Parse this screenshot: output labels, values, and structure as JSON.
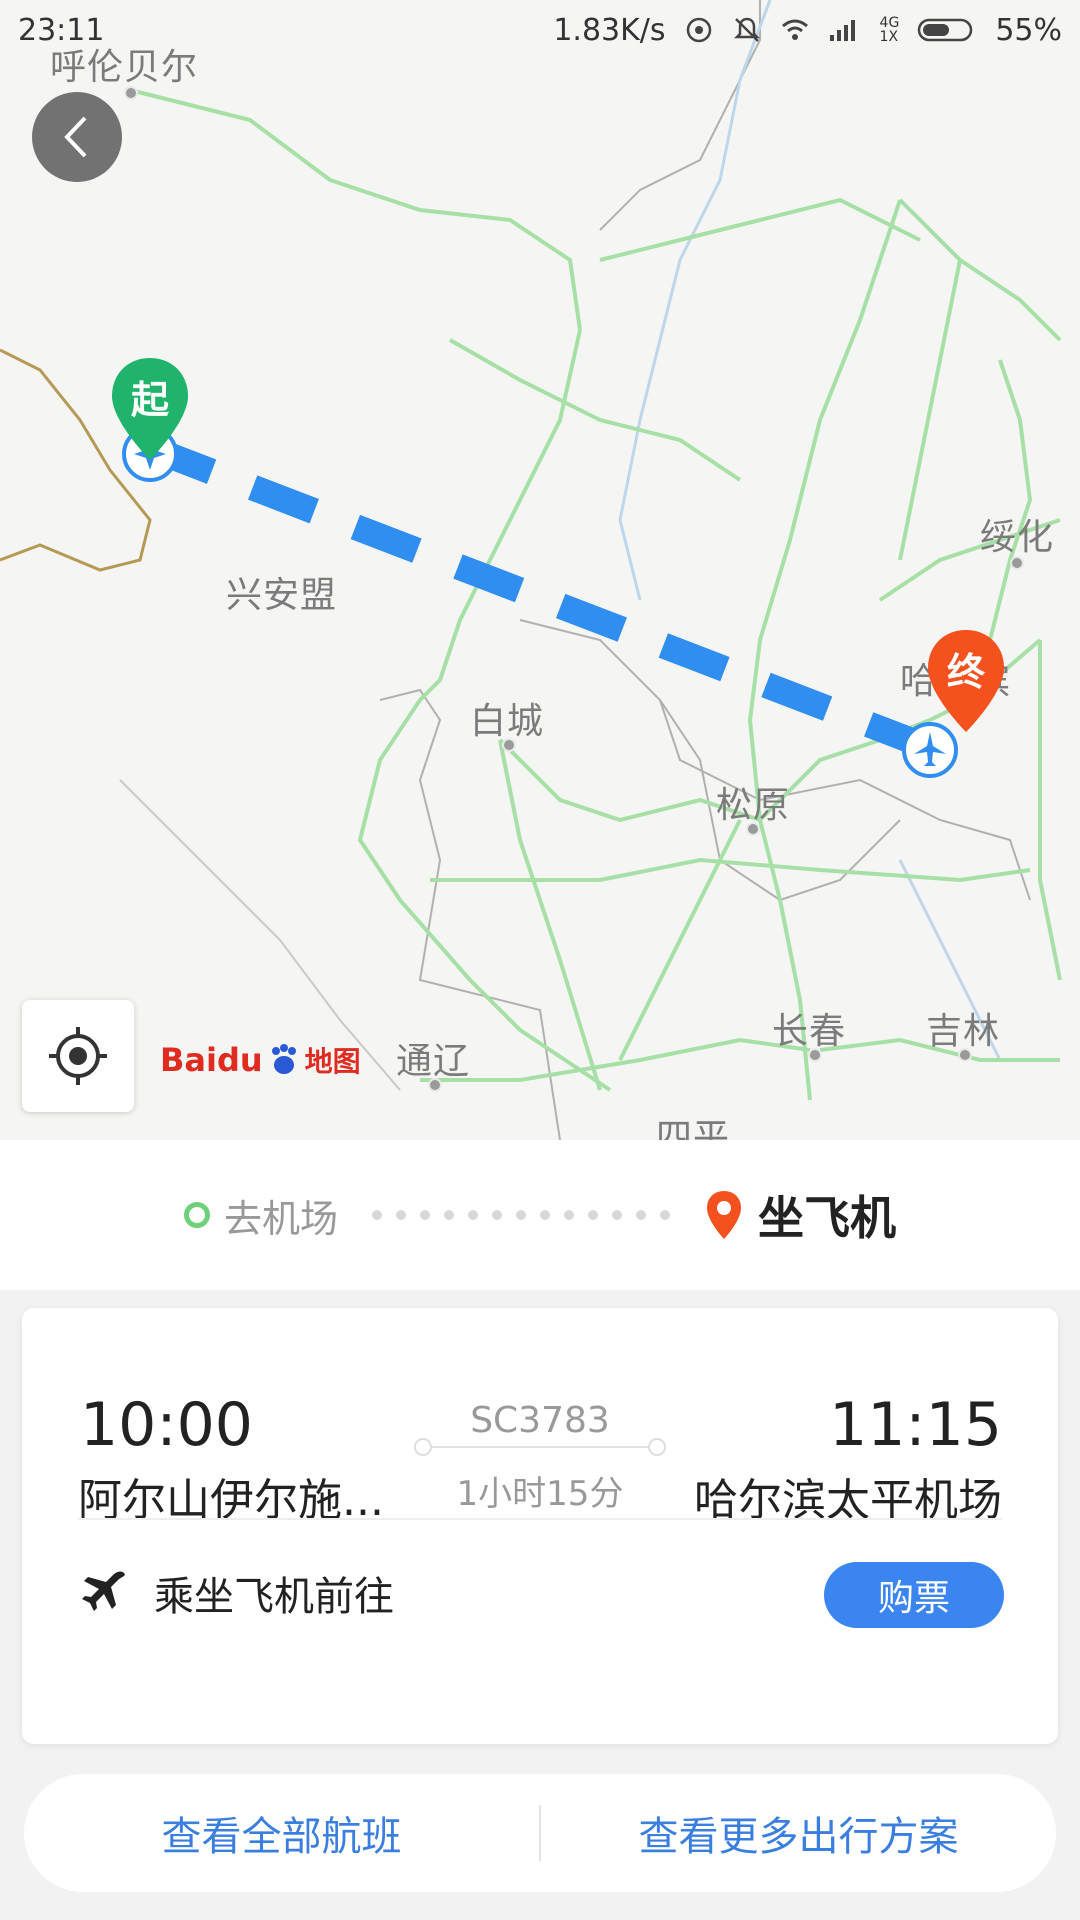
{
  "status_bar": {
    "time": "23:11",
    "speed": "1.83K/s",
    "network_top": "4G",
    "network_bottom": "1X",
    "battery": "55%"
  },
  "map": {
    "cities": [
      {
        "name": "呼伦贝尔"
      },
      {
        "name": "兴安盟"
      },
      {
        "name": "绥化"
      },
      {
        "name": "哈尔滨"
      },
      {
        "name": "白城"
      },
      {
        "name": "松原"
      },
      {
        "name": "通辽"
      },
      {
        "name": "长春"
      },
      {
        "name": "吉林"
      },
      {
        "name": "四平"
      }
    ],
    "start_label": "起",
    "end_label": "终",
    "logo_text": "Baidu",
    "logo_map_word": "地图"
  },
  "progress": {
    "step_left": "去机场",
    "step_right": "坐飞机"
  },
  "flight": {
    "dep_time": "10:00",
    "arr_time": "11:15",
    "flight_no": "SC3783",
    "duration": "1小时15分",
    "dep_airport": "阿尔山伊尔施...",
    "arr_airport": "哈尔滨太平机场",
    "plane_text": "乘坐飞机前往",
    "buy_label": "购票"
  },
  "bottom": {
    "all_flights": "查看全部航班",
    "more_plans": "查看更多出行方案"
  },
  "colors": {
    "accent_blue": "#3a85f0",
    "route_blue": "#2f8ef0",
    "start_green": "#1fb36b",
    "end_orange": "#f4511e",
    "road_green": "#9bdc9b"
  }
}
